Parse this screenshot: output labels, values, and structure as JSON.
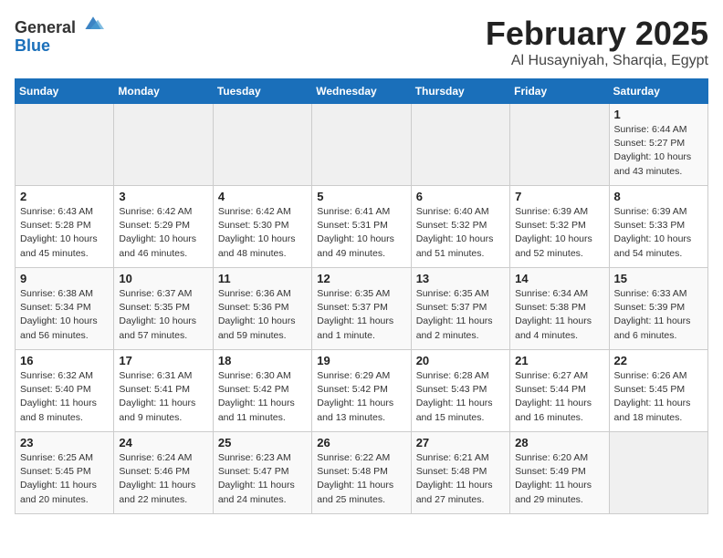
{
  "logo": {
    "general": "General",
    "blue": "Blue"
  },
  "title": "February 2025",
  "subtitle": "Al Husayniyah, Sharqia, Egypt",
  "weekdays": [
    "Sunday",
    "Monday",
    "Tuesday",
    "Wednesday",
    "Thursday",
    "Friday",
    "Saturday"
  ],
  "weeks": [
    [
      {
        "day": "",
        "info": ""
      },
      {
        "day": "",
        "info": ""
      },
      {
        "day": "",
        "info": ""
      },
      {
        "day": "",
        "info": ""
      },
      {
        "day": "",
        "info": ""
      },
      {
        "day": "",
        "info": ""
      },
      {
        "day": "1",
        "info": "Sunrise: 6:44 AM\nSunset: 5:27 PM\nDaylight: 10 hours and 43 minutes."
      }
    ],
    [
      {
        "day": "2",
        "info": "Sunrise: 6:43 AM\nSunset: 5:28 PM\nDaylight: 10 hours and 45 minutes."
      },
      {
        "day": "3",
        "info": "Sunrise: 6:42 AM\nSunset: 5:29 PM\nDaylight: 10 hours and 46 minutes."
      },
      {
        "day": "4",
        "info": "Sunrise: 6:42 AM\nSunset: 5:30 PM\nDaylight: 10 hours and 48 minutes."
      },
      {
        "day": "5",
        "info": "Sunrise: 6:41 AM\nSunset: 5:31 PM\nDaylight: 10 hours and 49 minutes."
      },
      {
        "day": "6",
        "info": "Sunrise: 6:40 AM\nSunset: 5:32 PM\nDaylight: 10 hours and 51 minutes."
      },
      {
        "day": "7",
        "info": "Sunrise: 6:39 AM\nSunset: 5:32 PM\nDaylight: 10 hours and 52 minutes."
      },
      {
        "day": "8",
        "info": "Sunrise: 6:39 AM\nSunset: 5:33 PM\nDaylight: 10 hours and 54 minutes."
      }
    ],
    [
      {
        "day": "9",
        "info": "Sunrise: 6:38 AM\nSunset: 5:34 PM\nDaylight: 10 hours and 56 minutes."
      },
      {
        "day": "10",
        "info": "Sunrise: 6:37 AM\nSunset: 5:35 PM\nDaylight: 10 hours and 57 minutes."
      },
      {
        "day": "11",
        "info": "Sunrise: 6:36 AM\nSunset: 5:36 PM\nDaylight: 10 hours and 59 minutes."
      },
      {
        "day": "12",
        "info": "Sunrise: 6:35 AM\nSunset: 5:37 PM\nDaylight: 11 hours and 1 minute."
      },
      {
        "day": "13",
        "info": "Sunrise: 6:35 AM\nSunset: 5:37 PM\nDaylight: 11 hours and 2 minutes."
      },
      {
        "day": "14",
        "info": "Sunrise: 6:34 AM\nSunset: 5:38 PM\nDaylight: 11 hours and 4 minutes."
      },
      {
        "day": "15",
        "info": "Sunrise: 6:33 AM\nSunset: 5:39 PM\nDaylight: 11 hours and 6 minutes."
      }
    ],
    [
      {
        "day": "16",
        "info": "Sunrise: 6:32 AM\nSunset: 5:40 PM\nDaylight: 11 hours and 8 minutes."
      },
      {
        "day": "17",
        "info": "Sunrise: 6:31 AM\nSunset: 5:41 PM\nDaylight: 11 hours and 9 minutes."
      },
      {
        "day": "18",
        "info": "Sunrise: 6:30 AM\nSunset: 5:42 PM\nDaylight: 11 hours and 11 minutes."
      },
      {
        "day": "19",
        "info": "Sunrise: 6:29 AM\nSunset: 5:42 PM\nDaylight: 11 hours and 13 minutes."
      },
      {
        "day": "20",
        "info": "Sunrise: 6:28 AM\nSunset: 5:43 PM\nDaylight: 11 hours and 15 minutes."
      },
      {
        "day": "21",
        "info": "Sunrise: 6:27 AM\nSunset: 5:44 PM\nDaylight: 11 hours and 16 minutes."
      },
      {
        "day": "22",
        "info": "Sunrise: 6:26 AM\nSunset: 5:45 PM\nDaylight: 11 hours and 18 minutes."
      }
    ],
    [
      {
        "day": "23",
        "info": "Sunrise: 6:25 AM\nSunset: 5:45 PM\nDaylight: 11 hours and 20 minutes."
      },
      {
        "day": "24",
        "info": "Sunrise: 6:24 AM\nSunset: 5:46 PM\nDaylight: 11 hours and 22 minutes."
      },
      {
        "day": "25",
        "info": "Sunrise: 6:23 AM\nSunset: 5:47 PM\nDaylight: 11 hours and 24 minutes."
      },
      {
        "day": "26",
        "info": "Sunrise: 6:22 AM\nSunset: 5:48 PM\nDaylight: 11 hours and 25 minutes."
      },
      {
        "day": "27",
        "info": "Sunrise: 6:21 AM\nSunset: 5:48 PM\nDaylight: 11 hours and 27 minutes."
      },
      {
        "day": "28",
        "info": "Sunrise: 6:20 AM\nSunset: 5:49 PM\nDaylight: 11 hours and 29 minutes."
      },
      {
        "day": "",
        "info": ""
      }
    ]
  ]
}
